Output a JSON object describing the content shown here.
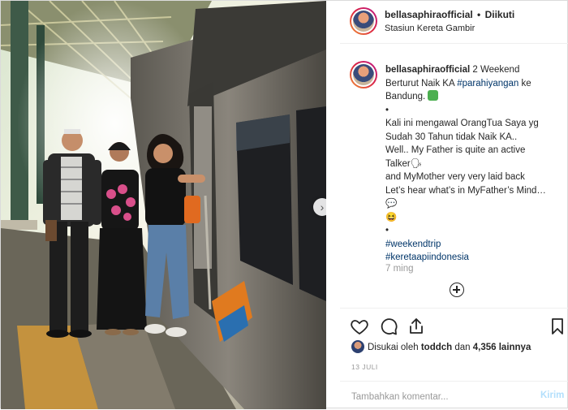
{
  "header": {
    "username": "bellasaphiraofficial",
    "separator": "•",
    "follow_status": "Diikuti",
    "location": "Stasiun Kereta Gambir"
  },
  "caption": {
    "username": "bellasaphiraofficial",
    "lines": [
      {
        "pre": " 2 Weekend",
        "tag": "",
        "post": ""
      },
      {
        "pre": "Berturut Naik KA ",
        "tag": "#parahiyangan",
        "post": " ke"
      },
      {
        "pre": "Bandung. ",
        "tag": "",
        "post": ""
      },
      {
        "pre": "•",
        "tag": "",
        "post": ""
      },
      {
        "pre": "Kali ini mengawal OrangTua Saya yg",
        "tag": "",
        "post": ""
      },
      {
        "pre": "Sudah 30 Tahun tidak Naik KA..",
        "tag": "",
        "post": ""
      },
      {
        "pre": "Well.. My Father is quite an active",
        "tag": "",
        "post": ""
      },
      {
        "pre": "Talker🗣",
        "tag": "",
        "post": ""
      },
      {
        "pre": "and MyMother very very laid back",
        "tag": "",
        "post": ""
      },
      {
        "pre": "Let’s hear what’s in MyFather’s Mind…",
        "tag": "",
        "post": ""
      },
      {
        "pre": "💬",
        "tag": "",
        "post": ""
      },
      {
        "pre": "😆",
        "tag": "",
        "post": ""
      },
      {
        "pre": "•",
        "tag": "",
        "post": ""
      },
      {
        "pre": "",
        "tag": "#weekendtrip",
        "post": ""
      },
      {
        "pre": "",
        "tag": "#keretaapiindonesia",
        "post": ""
      }
    ],
    "time_ago": "7 ming"
  },
  "actions": {
    "like_icon": "heart-icon",
    "comment_icon": "comment-icon",
    "share_icon": "share-icon",
    "save_icon": "bookmark-icon"
  },
  "likes": {
    "prefix": "Disukai oleh ",
    "user": "toddch",
    "middle": " dan ",
    "count": "4,356 lainnya"
  },
  "date": "13 JULI",
  "comment": {
    "placeholder": "Tambahkan komentar...",
    "post_label": "Kirim"
  },
  "colors": {
    "hashtag": "#003569",
    "post_button": "#b2dffc",
    "muted": "#999999"
  }
}
